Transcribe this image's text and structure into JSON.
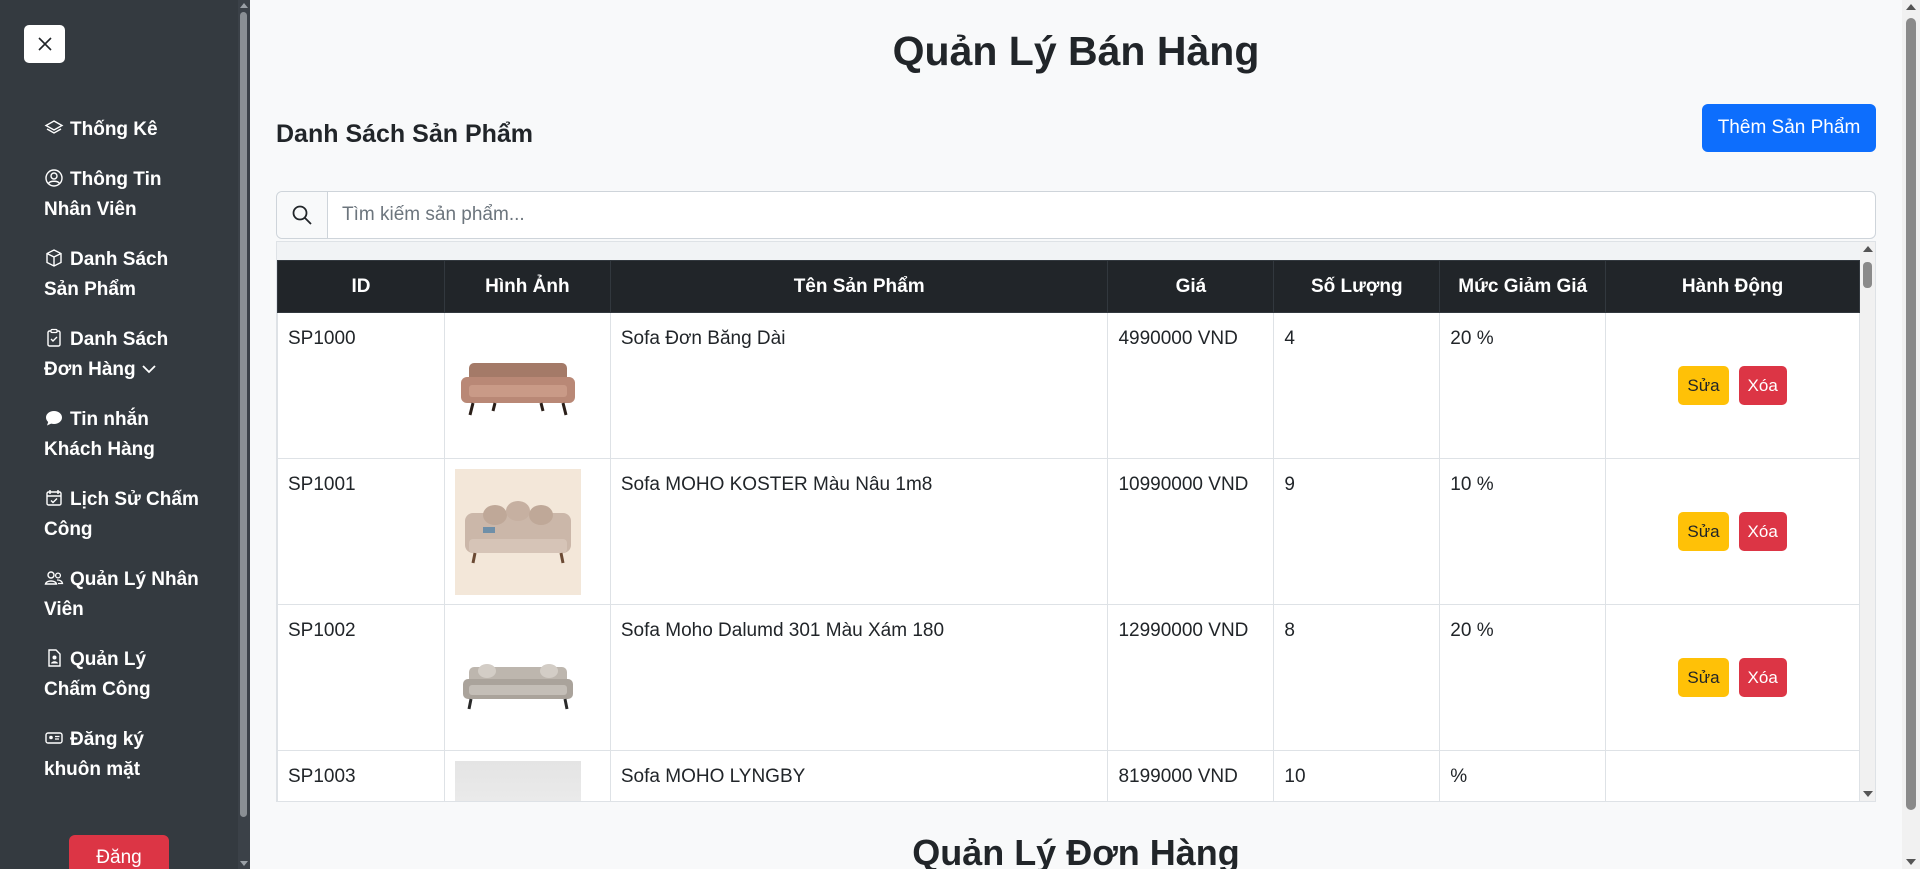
{
  "sidebar": {
    "close_label": "Close",
    "items": [
      {
        "label": "Thống Kê",
        "icon": "layers-icon"
      },
      {
        "label": "Thông Tin Nhân Viên",
        "icon": "user-circle-icon"
      },
      {
        "label": "Danh Sách Sản Phẩm",
        "icon": "box-icon"
      },
      {
        "label": "Danh Sách Đơn Hàng",
        "icon": "clipboard-check-icon"
      },
      {
        "label": "Tin nhắn Khách Hàng",
        "icon": "chat-icon"
      },
      {
        "label": "Lịch Sử Chấm Công",
        "icon": "calendar-check-icon"
      },
      {
        "label": "Quản Lý Nhân Viên",
        "icon": "people-icon"
      },
      {
        "label": "Quản Lý Chấm Công",
        "icon": "file-person-icon"
      },
      {
        "label": "Đăng ký khuôn mặt",
        "icon": "person-badge-icon"
      }
    ],
    "logout_label": "Đăng"
  },
  "main": {
    "title": "Quản Lý Bán Hàng",
    "section_title": "Danh Sách Sản Phẩm",
    "add_button": "Thêm Sản Phẩm",
    "search": {
      "placeholder": "Tìm kiếm sản phẩm...",
      "value": ""
    },
    "table": {
      "headers": [
        "ID",
        "Hình Ảnh",
        "Tên Sản Phẩm",
        "Giá",
        "Số Lượng",
        "Mức Giảm Giá",
        "Hành Động"
      ],
      "rows": [
        {
          "id": "SP1000",
          "name": "Sofa Đơn Băng Dài",
          "price": "4990000 VND",
          "qty": "4",
          "discount": "20 %"
        },
        {
          "id": "SP1001",
          "name": "Sofa MOHO KOSTER Màu Nâu 1m8",
          "price": "10990000 VND",
          "qty": "9",
          "discount": "10 %"
        },
        {
          "id": "SP1002",
          "name": "Sofa Moho Dalumd 301 Màu Xám 180",
          "price": "12990000 VND",
          "qty": "8",
          "discount": "20 %"
        },
        {
          "id": "SP1003",
          "name": "Sofa MOHO LYNGBY",
          "price": "8199000 VND",
          "qty": "10",
          "discount": "%"
        }
      ],
      "edit_label": "Sửa",
      "delete_label": "Xóa"
    },
    "section2_title": "Quản Lý Đơn Hàng"
  },
  "colors": {
    "sidebar_bg": "#343a40",
    "primary": "#0d6efd",
    "warning": "#ffc107",
    "danger": "#dc3545",
    "table_header": "#212529"
  }
}
